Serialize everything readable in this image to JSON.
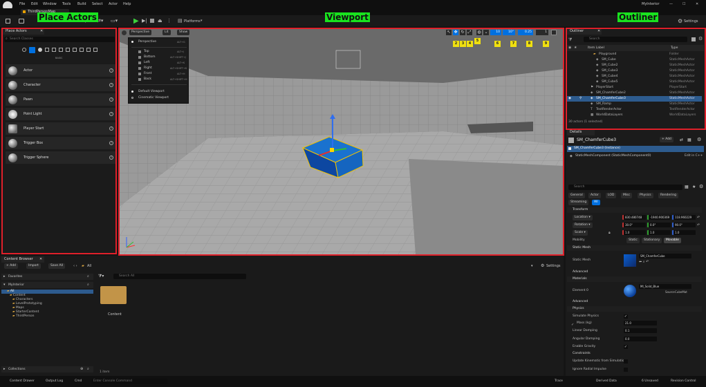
{
  "menu": {
    "items": [
      "File",
      "Edit",
      "Window",
      "Tools",
      "Build",
      "Select",
      "Actor",
      "Help"
    ],
    "project": "MyInterior"
  },
  "tabs": {
    "level": "ThirdPersonMap"
  },
  "toolbar": {
    "platforms": "Platforms",
    "settings": "Settings"
  },
  "annotations": {
    "place_actors": "Place Actors",
    "viewport": "Viewport",
    "outliner": "Outliner"
  },
  "place_actors": {
    "tab": "Place Actors",
    "search_placeholder": "Search Classes",
    "category": "BASIC",
    "items": [
      "Actor",
      "Character",
      "Pawn",
      "Point Light",
      "Player Start",
      "Trigger Box",
      "Trigger Sphere"
    ]
  },
  "viewport": {
    "perspective": "Perspective",
    "lit": "Lit",
    "show": "Show",
    "menu_items": [
      {
        "label": "Perspective",
        "shortcut": "ALT+G"
      },
      {
        "label": "Top",
        "shortcut": "ALT+J"
      },
      {
        "label": "Bottom",
        "shortcut": "ALT+SHIFT+J"
      },
      {
        "label": "Left",
        "shortcut": "ALT+K"
      },
      {
        "label": "Right",
        "shortcut": "ALT+SHIFT+K"
      },
      {
        "label": "Front",
        "shortcut": "ALT+H"
      },
      {
        "label": "Back",
        "shortcut": "ALT+SHIFT+H"
      }
    ],
    "menu_bottom": [
      "Default Viewport",
      "Cinematic Viewport"
    ],
    "snap_values": [
      "10",
      "10°",
      "0.25",
      "1"
    ],
    "badges": [
      "1",
      "2",
      "3",
      "4",
      "5",
      "6",
      "7",
      "8",
      "9"
    ]
  },
  "outliner": {
    "tab": "Outliner",
    "search_placeholder": "Search",
    "col_label": "Item Label",
    "col_type": "Type",
    "rows": [
      {
        "name": "Playground",
        "type": "Folder"
      },
      {
        "name": "SM_Cube",
        "type": "StaticMeshActor"
      },
      {
        "name": "SM_Cube2",
        "type": "StaticMeshActor"
      },
      {
        "name": "SM_Cube3",
        "type": "StaticMeshActor"
      },
      {
        "name": "SM_Cube4",
        "type": "StaticMeshActor"
      },
      {
        "name": "SM_Cube5",
        "type": "StaticMeshActor"
      },
      {
        "name": "PlayerStart",
        "type": "PlayerStart"
      },
      {
        "name": "SM_ChamferCube2",
        "type": "StaticMeshActor"
      },
      {
        "name": "SM_ChamferCube3",
        "type": "StaticMeshActor"
      },
      {
        "name": "SM_Ramp",
        "type": "StaticMeshActor"
      },
      {
        "name": "TextRenderActor",
        "type": "TextRenderActor"
      },
      {
        "name": "WorldDataLayers",
        "type": "WorldDataLayers"
      }
    ],
    "status": "30 actors (1 selected)"
  },
  "details": {
    "tab": "Details",
    "actor": "SM_ChamferCube3",
    "add": "+ Add",
    "instance": "SM_ChamferCube3 (Instance)",
    "component": "StaticMeshComponent (StaticMeshComponent0)",
    "edit_cpp": "Edit in C++",
    "search_placeholder": "Search",
    "filter_tabs": [
      "General",
      "Actor",
      "LOD",
      "Misc",
      "Physics",
      "Rendering",
      "Streaming",
      "All"
    ],
    "transform": "Transform",
    "location": {
      "label": "Location",
      "x": "830.480748",
      "y": "-1940.900369",
      "z": "118.960229"
    },
    "rotation": {
      "label": "Rotation",
      "x": "30.0°",
      "y": "0.0°",
      "z": "90.0°"
    },
    "scale": {
      "label": "Scale",
      "x": "1.0",
      "y": "1.0",
      "z": "1.0"
    },
    "mobility": {
      "label": "Mobility",
      "options": [
        "Static",
        "Stationary",
        "Movable"
      ]
    },
    "static_mesh_section": "Static Mesh",
    "static_mesh_label": "Static Mesh",
    "static_mesh_value": "SM_ChamferCube",
    "advanced": "Advanced",
    "materials_section": "Materials",
    "element0": "Element 0",
    "material_value": "MI_Solid_Blue",
    "material_source": "Source",
    "material_source_value": "CubeMat",
    "advanced2": "Advanced",
    "physics_section": "Physics",
    "simulate_physics": "Simulate Physics",
    "mass_label": "Mass (kg)",
    "mass_value": "21.0",
    "linear_damping": "Linear Damping",
    "linear_value": "0.1",
    "angular_damping": "Angular Damping",
    "angular_value": "0.0",
    "enable_gravity": "Enable Gravity",
    "constraints": "Constraints",
    "update_kinematic": "Update Kinematic from Simulation",
    "ignore_radial": "Ignore Radial Impulse"
  },
  "content_browser": {
    "tab": "Content Browser",
    "add": "+ Add",
    "import": "Import",
    "save_all": "Save All",
    "path": "All",
    "settings": "Settings",
    "favorites": "Favorites",
    "project": "MyInterior",
    "tree": [
      "All",
      "Content",
      "Characters",
      "LevelPrototyping",
      "Maps",
      "StarterContent",
      "ThirdPerson"
    ],
    "search_placeholder": "Search All",
    "folder": "Content",
    "items_count": "1 item",
    "collections": "Collections"
  },
  "statusbar": {
    "content_drawer": "Content Drawer",
    "output_log": "Output Log",
    "cmd": "Cmd",
    "console_placeholder": "Enter Console Command",
    "trace": "Trace",
    "derived": "Derived Data",
    "unsaved": "6 Unsaved",
    "revision": "Revision Control"
  },
  "colors": {
    "accent": "#0070e0",
    "highlight": "#e0202a",
    "tag": "#19e31f",
    "badge": "#f0e010",
    "cube": "#1565c0"
  }
}
